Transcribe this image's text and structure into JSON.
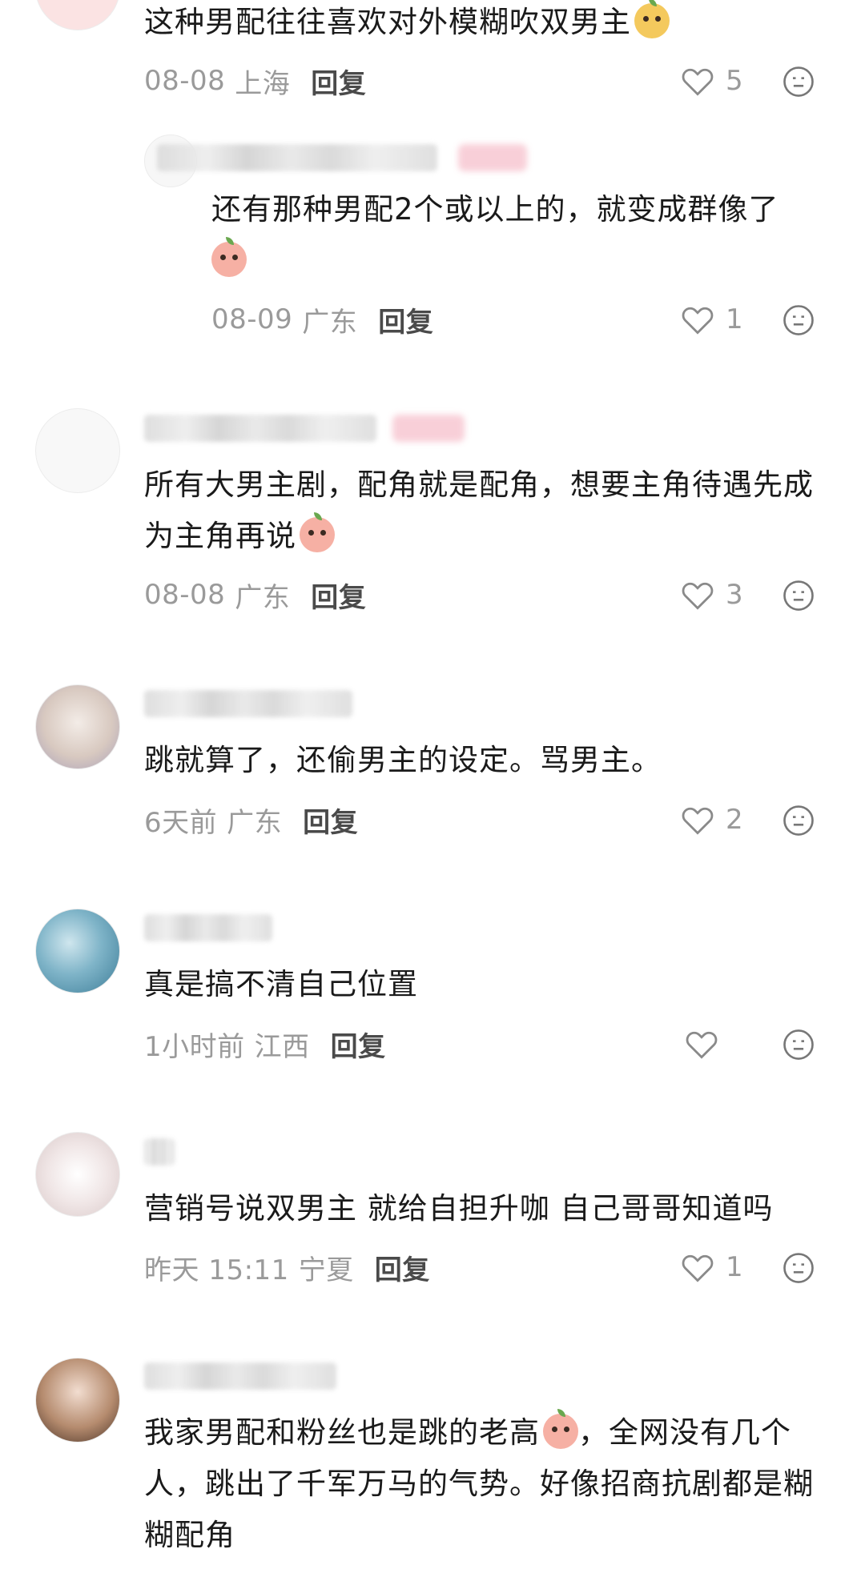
{
  "comments": [
    {
      "text": "这种男配往往喜欢对外模糊吹双男主",
      "date": "08-08",
      "location": "上海",
      "reply_label": "回复",
      "likes": "5",
      "emoji": "pear-emoji"
    },
    {
      "text": "还有那种男配2个或以上的，就变成群像了",
      "date": "08-09",
      "location": "广东",
      "reply_label": "回复",
      "likes": "1",
      "emoji": "crying-peach-emoji"
    },
    {
      "text": "所有大男主剧，配角就是配角，想要主角待遇先成为主角再说",
      "date": "08-08",
      "location": "广东",
      "reply_label": "回复",
      "likes": "3",
      "emoji": "peach-emoji"
    },
    {
      "text": "跳就算了，还偷男主的设定。骂男主。",
      "date": "6天前",
      "location": "广东",
      "reply_label": "回复",
      "likes": "2"
    },
    {
      "text": "真是搞不清自己位置",
      "date": "1小时前",
      "location": "江西",
      "reply_label": "回复",
      "likes": ""
    },
    {
      "text": "营销号说双男主 就给自担升咖 自己哥哥知道吗",
      "date": "昨天 15:11",
      "location": "宁夏",
      "reply_label": "回复",
      "likes": "1"
    },
    {
      "text_before_emoji": "我家男配和粉丝也是跳的老高",
      "text_after_emoji": "，全网没有几个人，跳出了千军万马的气势。好像招商抗剧都是糊糊配角",
      "emoji": "crying-peach-emoji"
    }
  ],
  "icons": {
    "like": "heart-outline-icon",
    "emoji_button": "smiley-icon"
  },
  "colors": {
    "text": "#1a1a1a",
    "meta": "#9a9a9a",
    "reply": "#4a4a4a"
  }
}
